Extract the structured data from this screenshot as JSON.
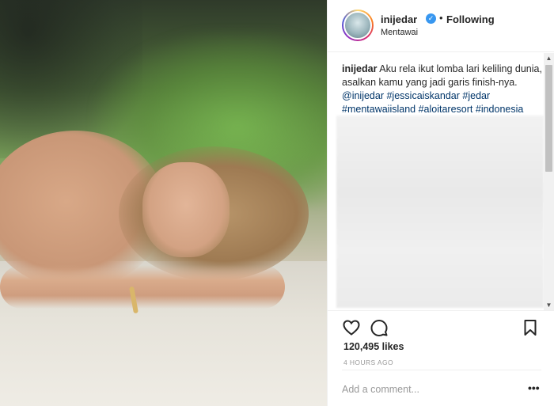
{
  "post": {
    "username": "inijedar",
    "follow_separator": "•",
    "follow_status": "Following",
    "location": "Mentawai",
    "caption_user": "inijedar",
    "caption_text": "Aku rela ikut lomba lari keliling dunia, asalkan kamu yang jadi garis finish-nya.",
    "mention": "@inijedar",
    "hashtags": [
      "#jessicaiskandar",
      "#jedar",
      "#mentawaiisland",
      "#aloitaresort",
      "#indonesia"
    ],
    "likes": "120,495 likes",
    "time_ago": "4 HOURS AGO"
  },
  "comment_box": {
    "placeholder": "Add a comment...",
    "more": "•••"
  },
  "colors": {
    "link": "#003569",
    "verified": "#3897f0",
    "muted": "#999999"
  },
  "icons": {
    "like": "heart-icon",
    "comment": "comment-bubble-icon",
    "save": "bookmark-icon",
    "verified": "verified-badge-icon"
  }
}
